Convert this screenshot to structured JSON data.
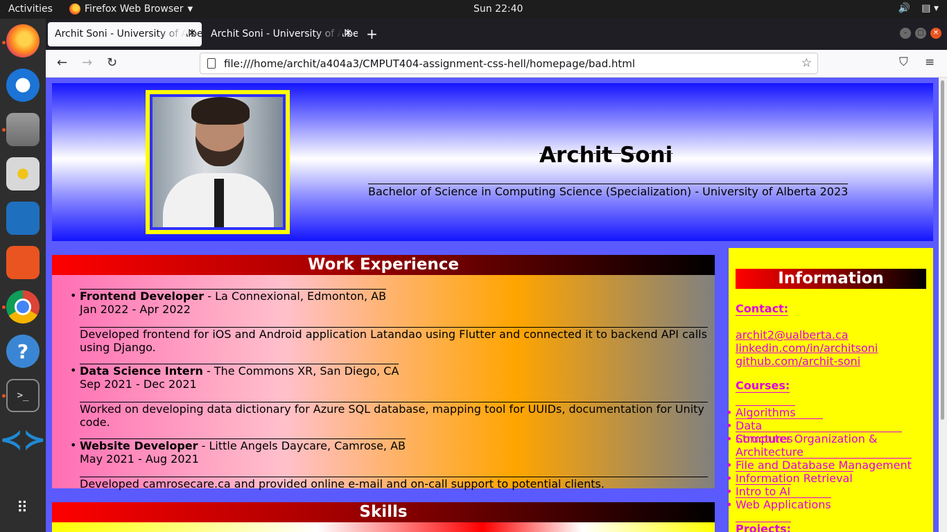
{
  "topbar": {
    "activities": "Activities",
    "app_name": "Firefox Web Browser",
    "clock": "Sun 22:40"
  },
  "browser": {
    "tabs": [
      {
        "title": "Archit Soni - University of Alberta"
      },
      {
        "title": "Archit Soni - University of Alberta"
      }
    ],
    "url": "file:///home/archit/a404a3/CMPUT404-assignment-css-hell/homepage/bad.html"
  },
  "page": {
    "header": {
      "name": "Archit Soni",
      "degree": "Bachelor of Science in Computing Science (Specialization) - University of Alberta 2023"
    },
    "work": {
      "title": "Work Experience",
      "jobs": [
        {
          "role": "Frontend Developer",
          "company": " - La Connexional, Edmonton, AB",
          "dates": "Jan 2022 - Apr 2022",
          "desc": "Developed frontend for iOS and Android application Latandao using Flutter and connected it to backend API calls using Django."
        },
        {
          "role": "Data Science Intern",
          "company": " - The Commons XR, San Diego, CA",
          "dates": "Sep 2021 - Dec 2021",
          "desc": "Worked on developing data dictionary for Azure SQL database, mapping tool for UUIDs, documentation for Unity code."
        },
        {
          "role": "Website Developer",
          "company": " - Little Angels Daycare, Camrose, AB",
          "dates": "May 2021 - Aug 2021",
          "desc": "Developed camrosecare.ca and provided online e-mail and on-call support to potential clients."
        }
      ]
    },
    "skills": {
      "title": "Skills"
    },
    "info": {
      "title": "Information",
      "contact_label": "Contact:",
      "contacts": [
        "archit2@ualberta.ca",
        "linkedin.com/in/architsoni",
        "github.com/archit-soni"
      ],
      "courses_label": "Courses:",
      "courses": [
        "Algorithms",
        "Data Structures",
        "Computer Organization & Architecture",
        "File and Database Management",
        "Information Retrieval",
        "Intro to AI",
        "Web Applications"
      ],
      "projects_label": "Projects:"
    }
  },
  "colors": {
    "header_blue": "#1414ff",
    "photo_border": "#ffff00",
    "sidebar_bg": "#ffff00",
    "link_magenta": "#e000e0",
    "title_gradient_start": "#ff0000"
  }
}
